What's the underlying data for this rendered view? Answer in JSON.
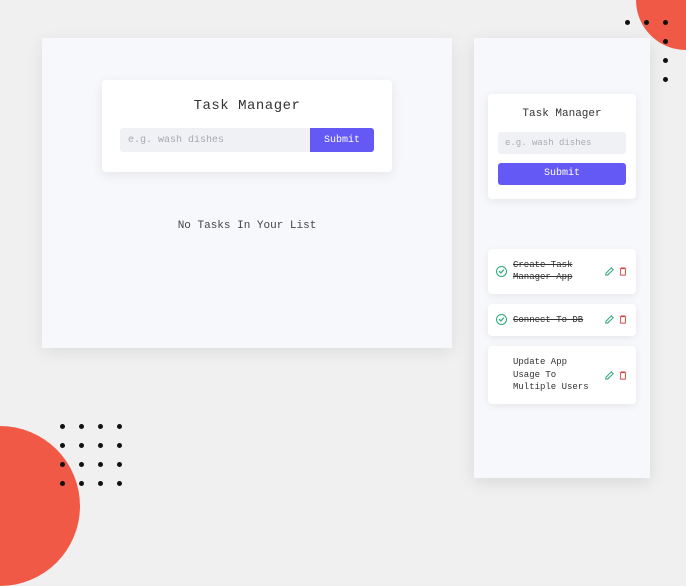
{
  "desktop": {
    "title": "Task Manager",
    "placeholder": "e.g. wash dishes",
    "submit_label": "Submit",
    "empty_message": "No Tasks In Your List"
  },
  "mobile": {
    "title": "Task Manager",
    "placeholder": "e.g. wash dishes",
    "submit_label": "Submit",
    "tasks": [
      {
        "text": "Create Task Manager App",
        "done": true
      },
      {
        "text": "Connect To DB",
        "done": true
      },
      {
        "text": "Update App Usage To Multiple Users",
        "done": false
      }
    ]
  },
  "icons": {
    "check": "check-icon",
    "edit": "edit-icon",
    "delete": "trash-icon"
  },
  "colors": {
    "accent": "#6459f5",
    "success": "#2ea879",
    "edit": "#2ea879",
    "delete": "#d04a4a",
    "circle": "#f15947"
  }
}
